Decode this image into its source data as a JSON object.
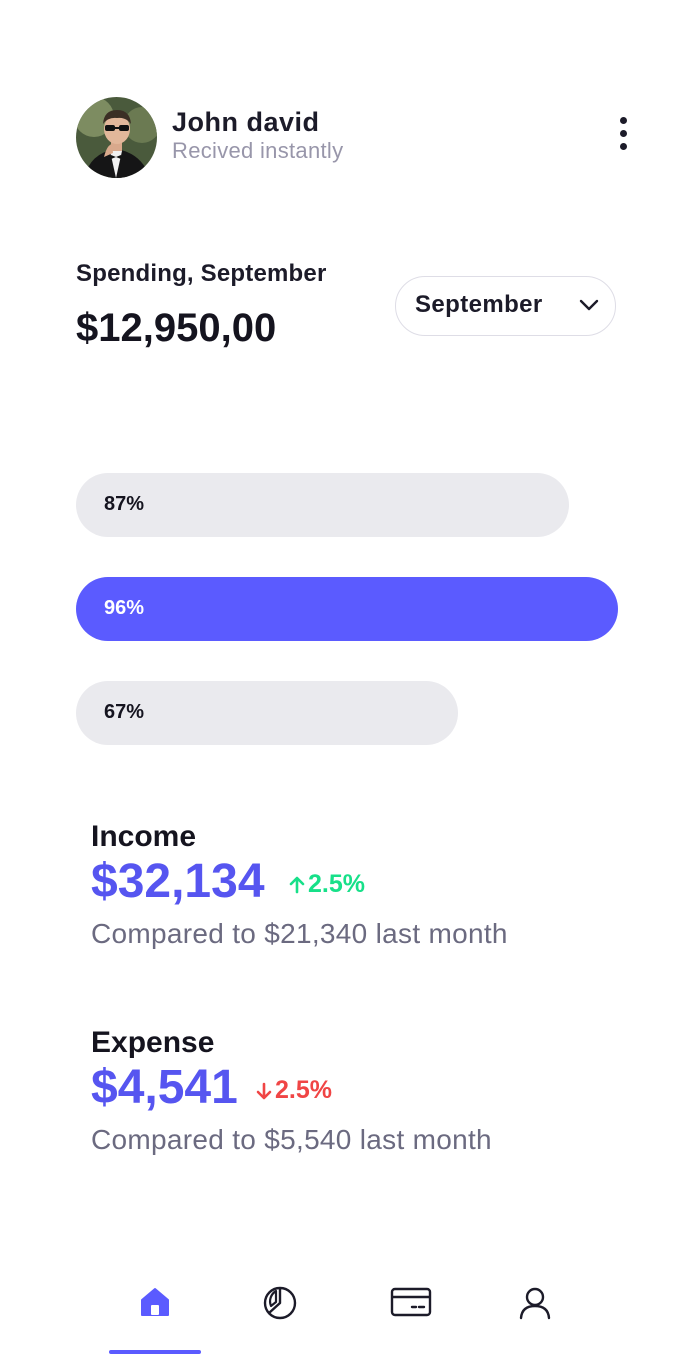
{
  "user": {
    "name": "John david",
    "subtitle": "Recived instantly"
  },
  "spending": {
    "label": "Spending, September",
    "amount": "$12,950,00",
    "month_select": "September"
  },
  "bars": [
    {
      "label": "87%",
      "value": 0.87,
      "active": false
    },
    {
      "label": "96%",
      "value": 0.96,
      "active": true
    },
    {
      "label": "67%",
      "value": 0.67,
      "active": false
    }
  ],
  "income": {
    "label": "Income",
    "value": "$32,134",
    "change": "2.5%",
    "direction": "up",
    "note": "Compared to $21,340 last month"
  },
  "expense": {
    "label": "Expense",
    "value": "$4,541",
    "change": "2.5%",
    "direction": "down",
    "note": "Compared to $5,540 last month"
  },
  "nav": [
    {
      "icon": "home-icon",
      "active": true
    },
    {
      "icon": "pie-chart-icon",
      "active": false
    },
    {
      "icon": "card-icon",
      "active": false
    },
    {
      "icon": "user-icon",
      "active": false
    }
  ],
  "colors": {
    "accent": "#5b5bff",
    "up": "#17e089",
    "down": "#f04545",
    "bar_inactive": "#eaeaee"
  }
}
